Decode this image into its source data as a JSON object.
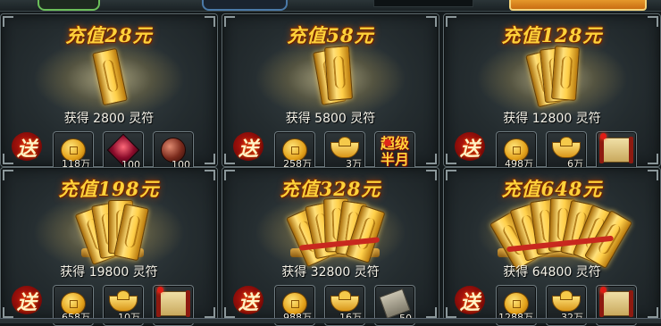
{
  "cards": [
    {
      "title": "充值28元",
      "gain": "获得 2800 灵符",
      "gift": "送",
      "items": [
        {
          "icon": "coin-icon",
          "count": "118万"
        },
        {
          "icon": "gem-red-icon",
          "count": "100"
        },
        {
          "icon": "orb-icon",
          "count": "100"
        }
      ]
    },
    {
      "title": "充值58元",
      "gain": "获得 5800 灵符",
      "gift": "送",
      "items": [
        {
          "icon": "coin-icon",
          "count": "258万"
        },
        {
          "icon": "ingot-icon",
          "count": "3万"
        },
        {
          "icon": "text-icon",
          "label": "超级\n半月",
          "count": ""
        }
      ]
    },
    {
      "title": "充值128元",
      "gain": "获得 12800 灵符",
      "gift": "送",
      "items": [
        {
          "icon": "coin-icon",
          "count": "498万"
        },
        {
          "icon": "ingot-icon",
          "count": "6万"
        },
        {
          "icon": "scroll-icon",
          "count": ""
        }
      ]
    },
    {
      "title": "充值198元",
      "gain": "获得 19800 灵符",
      "gift": "送",
      "items": [
        {
          "icon": "coin-icon",
          "count": "658万"
        },
        {
          "icon": "ingot-icon",
          "count": "10万"
        },
        {
          "icon": "scroll-icon",
          "count": ""
        }
      ]
    },
    {
      "title": "充值328元",
      "gain": "获得 32800 灵符",
      "gift": "送",
      "items": [
        {
          "icon": "coin-icon",
          "count": "988万"
        },
        {
          "icon": "ingot-icon",
          "count": "16万"
        },
        {
          "icon": "tile-icon",
          "count": "50"
        }
      ]
    },
    {
      "title": "充值648元",
      "gain": "获得 64800 灵符",
      "gift": "送",
      "items": [
        {
          "icon": "coin-icon",
          "count": "1288万"
        },
        {
          "icon": "ingot-icon",
          "count": "32万"
        },
        {
          "icon": "scroll-icon",
          "count": ""
        }
      ]
    }
  ]
}
